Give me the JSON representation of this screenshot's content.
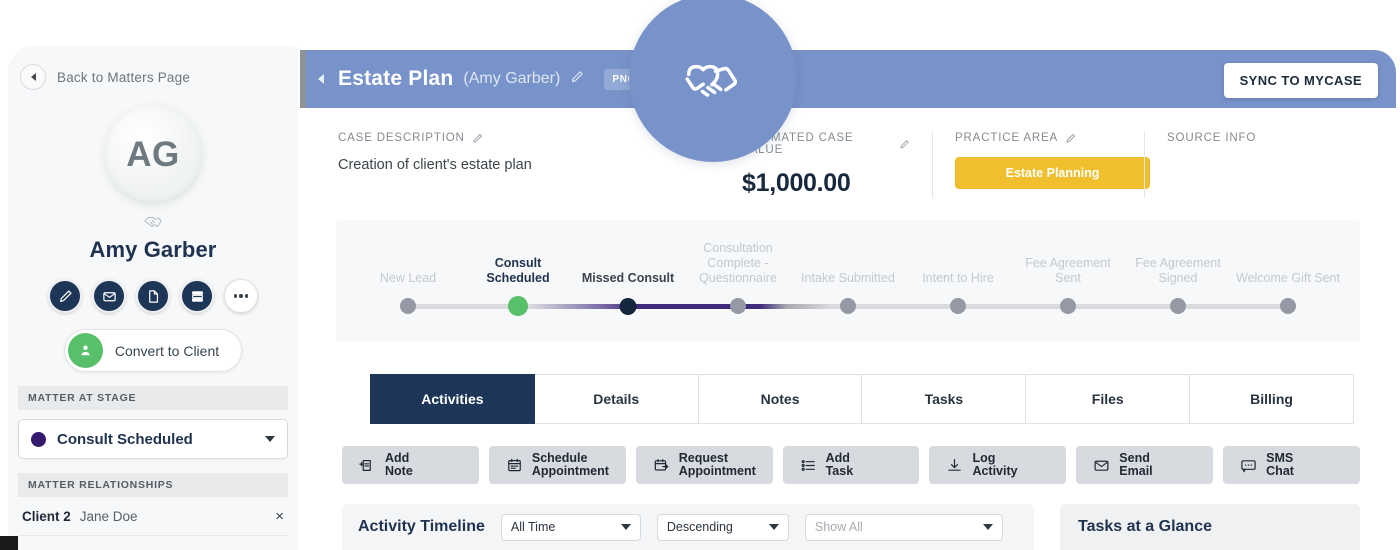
{
  "sidebar": {
    "back_label": "Back to Matters Page",
    "avatar_initials": "AG",
    "person_name": "Amy Garber",
    "icon_buttons": [
      {
        "name": "edit-icon",
        "label": "Edit"
      },
      {
        "name": "email-icon",
        "label": "Email"
      },
      {
        "name": "document-icon",
        "label": "Document"
      },
      {
        "name": "invoice-icon",
        "label": "Invoice"
      },
      {
        "name": "more-icon",
        "label": "More"
      }
    ],
    "convert_label": "Convert to Client",
    "stage_section_title": "MATTER AT STAGE",
    "stage_value": "Consult Scheduled",
    "stage_dot_color": "#34196e",
    "relationships_section_title": "MATTER RELATIONSHIPS",
    "relationships": [
      {
        "role": "Client 2",
        "name": "Jane Doe",
        "remove": "×"
      }
    ]
  },
  "header": {
    "title": "Estate Plan",
    "subtitle": "(Amy Garber)",
    "badge": "PNC",
    "sync_label": "SYNC TO MYCASE",
    "bar_color": "#7893c9",
    "floating_icon": "handshake-icon"
  },
  "info": {
    "case_description_label": "CASE DESCRIPTION",
    "case_description_value": "Creation of client's estate plan",
    "case_value_label": "ESTIMATED CASE VALUE",
    "case_value": "$1,000.00",
    "practice_area_label": "PRACTICE AREA",
    "practice_area_value": "Estate Planning",
    "practice_area_color": "#f0bf2e",
    "source_info_label": "SOURCE INFO"
  },
  "pipeline": {
    "active_color": "#58c06a",
    "stages": [
      {
        "label": "New Lead",
        "state": "pending"
      },
      {
        "label": "Consult Scheduled",
        "state": "active"
      },
      {
        "label": "Missed Consult",
        "state": "dark"
      },
      {
        "label": "Consultation Complete - Questionnaire",
        "state": "pending"
      },
      {
        "label": "Intake Submitted",
        "state": "pending"
      },
      {
        "label": "Intent to Hire",
        "state": "pending"
      },
      {
        "label": "Fee Agreement Sent",
        "state": "pending"
      },
      {
        "label": "Fee Agreement Signed",
        "state": "pending"
      },
      {
        "label": "Welcome Gift Sent",
        "state": "pending"
      }
    ]
  },
  "tabs": [
    {
      "label": "Activities",
      "active": true
    },
    {
      "label": "Details",
      "active": false
    },
    {
      "label": "Notes",
      "active": false
    },
    {
      "label": "Tasks",
      "active": false
    },
    {
      "label": "Files",
      "active": false
    },
    {
      "label": "Billing",
      "active": false
    }
  ],
  "actions": [
    {
      "line1": "Add",
      "line2": "Note",
      "icon": "add-note-icon"
    },
    {
      "line1": "Schedule",
      "line2": "Appointment",
      "icon": "calendar-icon"
    },
    {
      "line1": "Request",
      "line2": "Appointment",
      "icon": "calendar-arrow-icon"
    },
    {
      "line1": "Add",
      "line2": "Task",
      "icon": "task-list-icon"
    },
    {
      "line1": "Log",
      "line2": "Activity",
      "icon": "download-icon"
    },
    {
      "line1": "Send",
      "line2": "Email",
      "icon": "envelope-icon"
    },
    {
      "line1": "SMS",
      "line2": "Chat",
      "icon": "chat-icon"
    }
  ],
  "timeline": {
    "title": "Activity Timeline",
    "filters": [
      {
        "value": "All Time",
        "placeholder": false
      },
      {
        "value": "Descending",
        "placeholder": false
      },
      {
        "value": "Show All",
        "placeholder": true
      }
    ]
  },
  "tasks_panel": {
    "title": "Tasks at a Glance"
  }
}
